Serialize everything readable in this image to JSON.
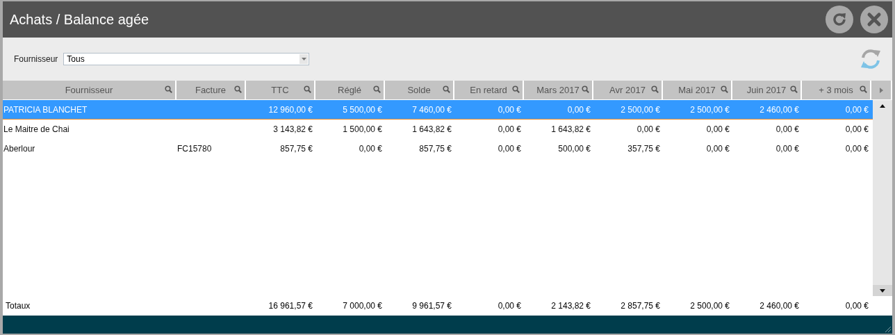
{
  "window": {
    "title": "Achats / Balance agée"
  },
  "filter": {
    "label": "Fournisseur",
    "value": "Tous"
  },
  "table": {
    "columns": [
      "Fournisseur",
      "Facture",
      "TTC",
      "Réglé",
      "Solde",
      "En retard",
      "Mars 2017",
      "Avr 2017",
      "Mai 2017",
      "Juin 2017",
      "+ 3 mois"
    ],
    "rows": [
      {
        "selected": true,
        "supplier": "PATRICIA BLANCHET",
        "amounts": [
          "12 960,00 €",
          "5 500,00 €",
          "7 460,00 €",
          "0,00 €",
          "0,00 €",
          "2 500,00 €",
          "2 500,00 €",
          "2 460,00 €",
          "0,00 €"
        ]
      },
      {
        "selected": false,
        "supplier": "Le Maitre de Chai",
        "amounts": [
          "3 143,82 €",
          "1 500,00 €",
          "1 643,82 €",
          "0,00 €",
          "1 643,82 €",
          "0,00 €",
          "0,00 €",
          "0,00 €",
          "0,00 €"
        ]
      },
      {
        "selected": false,
        "supplier": "Aberlour",
        "invoice": "FC15780",
        "amounts": [
          "857,75 €",
          "0,00 €",
          "857,75 €",
          "0,00 €",
          "500,00 €",
          "357,75 €",
          "0,00 €",
          "0,00 €",
          "0,00 €"
        ]
      }
    ],
    "totals": {
      "label": "Totaux",
      "amounts": [
        "16 961,57 €",
        "7 000,00 €",
        "9 961,57 €",
        "0,00 €",
        "2 143,82 €",
        "2 857,75 €",
        "2 500,00 €",
        "2 460,00 €",
        "0,00 €"
      ]
    }
  }
}
